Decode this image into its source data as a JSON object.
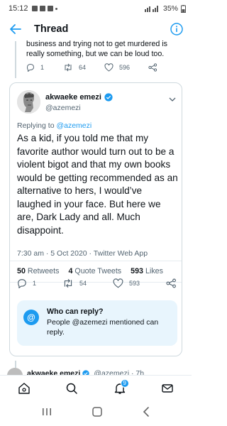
{
  "status_bar": {
    "time": "15:12",
    "battery": "35%"
  },
  "app_bar": {
    "title": "Thread"
  },
  "previous_tweet": {
    "text": "business and trying not to get murdered is really something, but we can be loud too.",
    "replies": "1",
    "retweets": "64",
    "likes": "596"
  },
  "tweet": {
    "author_name": "akwaeke emezi",
    "handle": "@azemezi",
    "replying_label": "Replying to",
    "replying_to": "@azemezi",
    "text": "As a kid, if you told me that my favorite author would turn out to be a violent bigot and that my own books would be getting recommended as an alternative to hers, I would’ve laughed in your face. But here we are, Dark Lady and all. Much disappoint.",
    "meta": "7:30 am · 5 Oct 2020 · Twitter Web App",
    "stats": {
      "retweets_count": "50",
      "retweets_label": "Retweets",
      "quotes_count": "4",
      "quotes_label": "Quote Tweets",
      "likes_count": "593",
      "likes_label": "Likes"
    },
    "actions": {
      "replies": "1",
      "retweets": "54",
      "likes": "593"
    },
    "who_can_reply": {
      "title": "Who can reply?",
      "text": "People @azemezi mentioned can reply."
    }
  },
  "next_tweet": {
    "author_name": "akwaeke emezi",
    "handle": "@azemezi · 7h"
  },
  "bottom_nav": {
    "notifications_badge": "9"
  },
  "colors": {
    "accent": "#1d9bf0",
    "text": "#0f1419",
    "secondary": "#536471",
    "divider": "#e6ecf0"
  }
}
